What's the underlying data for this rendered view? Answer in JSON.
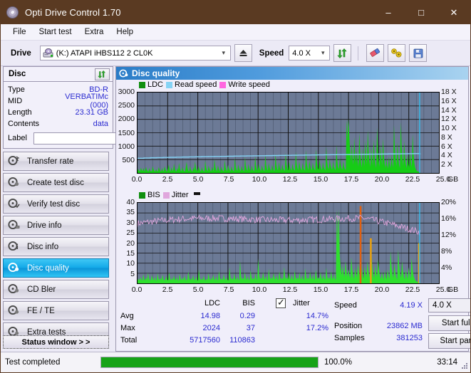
{
  "window": {
    "title": "Opti Drive Control 1.70",
    "icon": "optical-disc-icon",
    "minimize": "–",
    "maximize": "□",
    "close": "✕"
  },
  "menu": [
    {
      "label": "File"
    },
    {
      "label": "Start test"
    },
    {
      "label": "Extra"
    },
    {
      "label": "Help"
    }
  ],
  "toolbar": {
    "drive_label": "Drive",
    "drive_value": "(K:)  ATAPI iHBS112  2 CL0K",
    "eject_icon": "eject-icon",
    "speed_label": "Speed",
    "speed_value": "4.0 X",
    "refresh_icon": "refresh-icon",
    "eraser_icon": "eraser-icon",
    "tools_icon": "tools-icon",
    "save_icon": "save-icon"
  },
  "disc_panel": {
    "title": "Disc",
    "refresh_icon": "refresh-icon",
    "rows": [
      {
        "key": "Type",
        "value": "BD-R"
      },
      {
        "key": "MID",
        "value": "VERBATIMc (000)"
      },
      {
        "key": "Length",
        "value": "23.31 GB"
      },
      {
        "key": "Contents",
        "value": "data"
      }
    ],
    "label_key": "Label",
    "label_value": "",
    "label_button_icon": "disc-icon"
  },
  "sidebar": {
    "items": [
      {
        "label": "Transfer rate",
        "icon": "disc-transfer-icon",
        "active": false
      },
      {
        "label": "Create test disc",
        "icon": "disc-create-icon",
        "active": false
      },
      {
        "label": "Verify test disc",
        "icon": "disc-verify-icon",
        "active": false
      },
      {
        "label": "Drive info",
        "icon": "disc-drive-icon",
        "active": false
      },
      {
        "label": "Disc info",
        "icon": "disc-info-icon",
        "active": false
      },
      {
        "label": "Disc quality",
        "icon": "disc-quality-icon",
        "active": true
      },
      {
        "label": "CD Bler",
        "icon": "disc-bler-icon",
        "active": false
      },
      {
        "label": "FE / TE",
        "icon": "disc-fete-icon",
        "active": false
      },
      {
        "label": "Extra tests",
        "icon": "disc-extra-icon",
        "active": false
      }
    ],
    "status_window": "Status window > >"
  },
  "panel": {
    "header": "Disc quality",
    "header_icon": "disc-quality-icon"
  },
  "chart_data": [
    {
      "type": "line",
      "name": "ldc-chart",
      "title": "",
      "xlabel": "GB",
      "ylabel": "",
      "xlim": [
        0.0,
        25.0
      ],
      "xticks": [
        "0.0",
        "2.5",
        "5.0",
        "7.5",
        "10.0",
        "12.5",
        "15.0",
        "17.5",
        "20.0",
        "22.5",
        "25.0"
      ],
      "x_unit": "GB",
      "ylim": [
        0,
        3000
      ],
      "yticks": [
        "500",
        "1000",
        "1500",
        "2000",
        "2500",
        "3000"
      ],
      "y2lim": [
        0,
        18
      ],
      "y2ticks": [
        "2 X",
        "4 X",
        "6 X",
        "8 X",
        "10 X",
        "12 X",
        "14 X",
        "16 X",
        "18 X"
      ],
      "grid": true,
      "legend": [
        {
          "label": "LDC",
          "color": "#0f8f0f"
        },
        {
          "label": "Read speed",
          "color": "#86d3f5"
        },
        {
          "label": "Write speed",
          "color": "#ff66e0"
        }
      ],
      "series": [
        {
          "name": "LDC",
          "color": "#16cc16",
          "type": "area",
          "values": [
            90,
            150,
            80,
            60,
            200,
            110,
            70,
            190,
            90,
            60,
            230,
            120,
            70,
            60,
            180,
            90,
            60,
            70,
            250,
            130,
            70,
            60,
            150,
            70,
            60,
            220,
            110,
            70,
            60,
            190,
            80,
            60,
            260,
            140,
            70,
            60,
            180,
            320,
            90,
            60,
            210,
            110,
            70,
            350,
            150,
            80,
            60,
            190,
            100,
            380,
            170,
            90,
            60,
            230,
            120,
            70,
            60,
            200,
            420,
            180,
            90,
            60,
            250,
            130,
            70,
            60,
            210,
            110,
            430,
            190,
            100,
            70,
            260,
            140,
            80,
            60,
            220,
            115,
            70,
            60,
            470,
            200,
            105,
            70,
            280,
            150,
            85,
            60,
            230,
            120,
            70,
            520,
            220,
            110,
            70,
            290,
            160,
            90,
            60,
            240,
            125,
            75,
            60,
            480,
            210,
            110,
            70,
            300,
            165,
            95,
            65,
            250,
            130,
            80,
            60,
            560,
            240,
            120,
            75,
            320,
            175,
            100,
            70,
            270,
            140,
            85,
            65,
            590,
            250,
            130,
            80,
            340,
            185,
            105,
            72,
            280,
            150,
            90,
            68,
            620,
            260,
            135,
            85,
            350,
            190,
            110,
            75,
            290,
            155,
            95,
            70,
            680,
            290,
            145,
            90,
            380,
            205,
            120,
            80,
            310,
            165,
            100,
            75,
            720,
            300,
            150,
            95,
            400,
            215,
            125,
            85,
            330,
            175,
            105,
            80,
            760,
            320,
            160,
            100,
            420,
            225,
            135,
            90,
            350,
            185,
            115,
            85,
            800,
            340,
            170,
            105,
            440,
            240,
            140,
            95,
            370,
            195,
            120,
            90,
            860,
            360,
            180,
            110,
            470,
            255,
            150,
            100,
            390,
            205,
            130,
            95,
            900,
            380,
            190,
            120,
            500,
            270,
            160,
            105,
            410,
            220,
            135,
            100,
            980,
            410,
            205,
            125,
            530,
            285,
            170,
            115,
            440,
            230,
            145,
            105,
            1050,
            440,
            220,
            135,
            560,
            300,
            180,
            120,
            460,
            245,
            150,
            110,
            1980,
            1200,
            2024,
            1500,
            900,
            420,
            1100,
            600,
            300,
            1350,
            700,
            350,
            880,
            450,
            230,
            1500,
            800,
            400,
            200,
            950,
            480,
            250,
            1200,
            620,
            320,
            1600,
            850,
            430,
            220,
            1000,
            520,
            270,
            1250,
            650,
            330,
            180,
            1700,
            880,
            450,
            230,
            1050,
            550,
            280,
            1300,
            680,
            340,
            190,
            560,
            290,
            160,
            620,
            320,
            180,
            700,
            360,
            200,
            1800,
            940,
            480,
            250,
            1150,
            600,
            310,
            170,
            1900,
            980,
            500,
            260,
            1200,
            630,
            320,
            180,
            700,
            360,
            200,
            800,
            420,
            220,
            1450,
            760,
            390,
            210,
            120,
            80,
            60,
            50,
            40,
            30
          ]
        },
        {
          "name": "Read speed",
          "color": "#86d3f5",
          "type": "line",
          "start_x": 0.0,
          "end_x": 23.4,
          "start_value": 3.3,
          "end_value": 4.35,
          "note": "stepped monotonic rise from ~3.3X to ~4.35X then vertical spike to 18X at 23.4 GB"
        }
      ],
      "cursor_line": {
        "x": 23.4,
        "color": "#2fc3f5"
      }
    },
    {
      "type": "line",
      "name": "bis-jitter-chart",
      "title": "",
      "xlabel": "GB",
      "xlim": [
        0.0,
        25.0
      ],
      "xticks": [
        "0.0",
        "2.5",
        "5.0",
        "7.5",
        "10.0",
        "12.5",
        "15.0",
        "17.5",
        "20.0",
        "22.5",
        "25.0"
      ],
      "ylim": [
        0,
        40
      ],
      "yticks": [
        "5",
        "10",
        "15",
        "20",
        "25",
        "30",
        "35",
        "40"
      ],
      "y2lim": [
        0,
        20
      ],
      "y2ticks": [
        "4%",
        "8%",
        "12%",
        "16%",
        "20%"
      ],
      "grid": true,
      "legend": [
        {
          "label": "BIS",
          "color": "#0f8f0f"
        },
        {
          "label": "Jitter",
          "color": "#e0a6dd"
        }
      ],
      "series": [
        {
          "name": "BIS",
          "color": "#2ee02e",
          "type": "area",
          "values": [
            1.5,
            2.2,
            1.4,
            3.1,
            1.8,
            1.3,
            4.5,
            2.0,
            1.5,
            3.0,
            1.6,
            5.2,
            2.3,
            1.4,
            1.8,
            4.1,
            2.0,
            1.5,
            3.3,
            1.7,
            1.3,
            5.0,
            2.2,
            1.6,
            2.8,
            1.5,
            4.3,
            2.1,
            1.4,
            1.9,
            3.6,
            1.8,
            1.4,
            5.5,
            2.4,
            1.5,
            2.7,
            1.6,
            4.0,
            2.0,
            1.5,
            3.2,
            1.7,
            1.3,
            4.8,
            2.2,
            1.6,
            2.9,
            1.5,
            3.8,
            1.9,
            1.4,
            2.1,
            5.9,
            2.5,
            1.6,
            2.6,
            1.5,
            4.2,
            2.0,
            1.4,
            3.4,
            1.8,
            1.3,
            7.0,
            2.6,
            1.7,
            2.4,
            1.5,
            3.9,
            1.9,
            1.4,
            2.2,
            1.6,
            5.1,
            2.3,
            1.5,
            2.8,
            1.6,
            4.4,
            2.1,
            1.5,
            3.5,
            1.8,
            1.4,
            6.2,
            2.7,
            1.8,
            2.5,
            1.6,
            4.6,
            2.2,
            1.5,
            3.1,
            1.7,
            1.4,
            8.0,
            3.0,
            1.9,
            2.6,
            1.7,
            4.9,
            2.3,
            1.6,
            3.3,
            1.8,
            1.5,
            11.2,
            3.4,
            2.0,
            2.7,
            1.8,
            5.4,
            2.5,
            1.7,
            3.6,
            1.9,
            1.5,
            6.6,
            2.8,
            1.9,
            2.8,
            1.8,
            5.0,
            2.4,
            1.7,
            12.2,
            3.6,
            2.1,
            2.9,
            1.9,
            5.6,
            2.6,
            1.8,
            3.8,
            2.0,
            1.6,
            7.2,
            3.0,
            2.0,
            3.0,
            1.9,
            5.2,
            2.5,
            1.8,
            4.0,
            2.1,
            1.7,
            6.0,
            2.8,
            1.9,
            2.9,
            1.8,
            8.2,
            3.2,
            2.1,
            3.1,
            2.0,
            5.5,
            2.6,
            1.8,
            4.2,
            2.2,
            1.7,
            6.4,
            2.9,
            2.0,
            3.0,
            1.9,
            5.3,
            2.5,
            1.8,
            4.1,
            2.1,
            1.7,
            7.5,
            3.1,
            2.0,
            3.0,
            1.9,
            5.8,
            2.7,
            1.9,
            4.3,
            2.2,
            1.8,
            6.8,
            3.0,
            2.0,
            3.1,
            2.0,
            5.6,
            2.6,
            1.9,
            4.4,
            2.3,
            1.8,
            7.8,
            3.2,
            2.1,
            3.2,
            2.0,
            6.0,
            2.8,
            1.9,
            4.5,
            2.3,
            1.8,
            37,
            20,
            37,
            14,
            8,
            4,
            9,
            5,
            3,
            11,
            6,
            3.2,
            7,
            4,
            2.5,
            13,
            7,
            3.6,
            2.2,
            8,
            4.5,
            2.6,
            10,
            5.5,
            3,
            14,
            7.5,
            4,
            2.4,
            8.5,
            4.8,
            2.8,
            11,
            6,
            3.2,
            2,
            15,
            8,
            4.2,
            2.5,
            9,
            5,
            2.9,
            12,
            6.5,
            3.4,
            2.1,
            5.8,
            3,
            1.9,
            6.2,
            3.2,
            2,
            7,
            3.6,
            2.2,
            16,
            8.5,
            4.4,
            2.6,
            10,
            5.2,
            3,
            1.9,
            17,
            9,
            4.6,
            2.7,
            11,
            6,
            3.1,
            2,
            7,
            3.5,
            2.1,
            8,
            4,
            2.3,
            13,
            7,
            3.7,
            2.2,
            1.4,
            1.0,
            0.8,
            0.6,
            0.5,
            0.4
          ]
        },
        {
          "name": "Jitter",
          "color": "#e0a6dd",
          "type": "line",
          "mean": 14.7,
          "max": 17.2,
          "note": "noisy band around 30 units (≈15%), rising slightly mid-disc then falling to ~12% at end"
        }
      ],
      "overlay_spikes": [
        {
          "x": 18.5,
          "color": "#e06010",
          "height_pct": 96
        },
        {
          "x": 19.35,
          "color": "#e8a010",
          "height_pct": 56
        },
        {
          "x": 23.35,
          "color": "#e8a010",
          "height_pct": 50
        }
      ],
      "cursor_line": {
        "x": 23.4,
        "color": "#2fc3f5"
      }
    }
  ],
  "stats": {
    "col_headers": [
      "LDC",
      "BIS"
    ],
    "rows": [
      {
        "label": "Avg",
        "ldc": "14.98",
        "bis": "0.29",
        "jitter": "14.7%"
      },
      {
        "label": "Max",
        "ldc": "2024",
        "bis": "37",
        "jitter": "17.2%"
      },
      {
        "label": "Total",
        "ldc": "5717560",
        "bis": "110863",
        "jitter": ""
      }
    ],
    "jitter_label": "Jitter",
    "jitter_checked": true,
    "speed_label": "Speed",
    "speed_value": "4.19 X",
    "position_label": "Position",
    "position_value": "23862 MB",
    "samples_label": "Samples",
    "samples_value": "381253",
    "speed_select": "4.0 X",
    "start_full": "Start full",
    "start_part": "Start part"
  },
  "statusbar": {
    "text": "Test completed",
    "progress_pct": "100.0%",
    "progress_value": 100,
    "elapsed": "33:14"
  },
  "colors": {
    "title_bg": "#5a3a22",
    "accent": "#2b2bd0",
    "ldc_green": "#16cc16",
    "read_speed": "#86d3f5",
    "write_speed": "#ff66e0",
    "jitter": "#e0a6dd",
    "plot_bg": "#6c7a96",
    "progress": "#17a317"
  }
}
